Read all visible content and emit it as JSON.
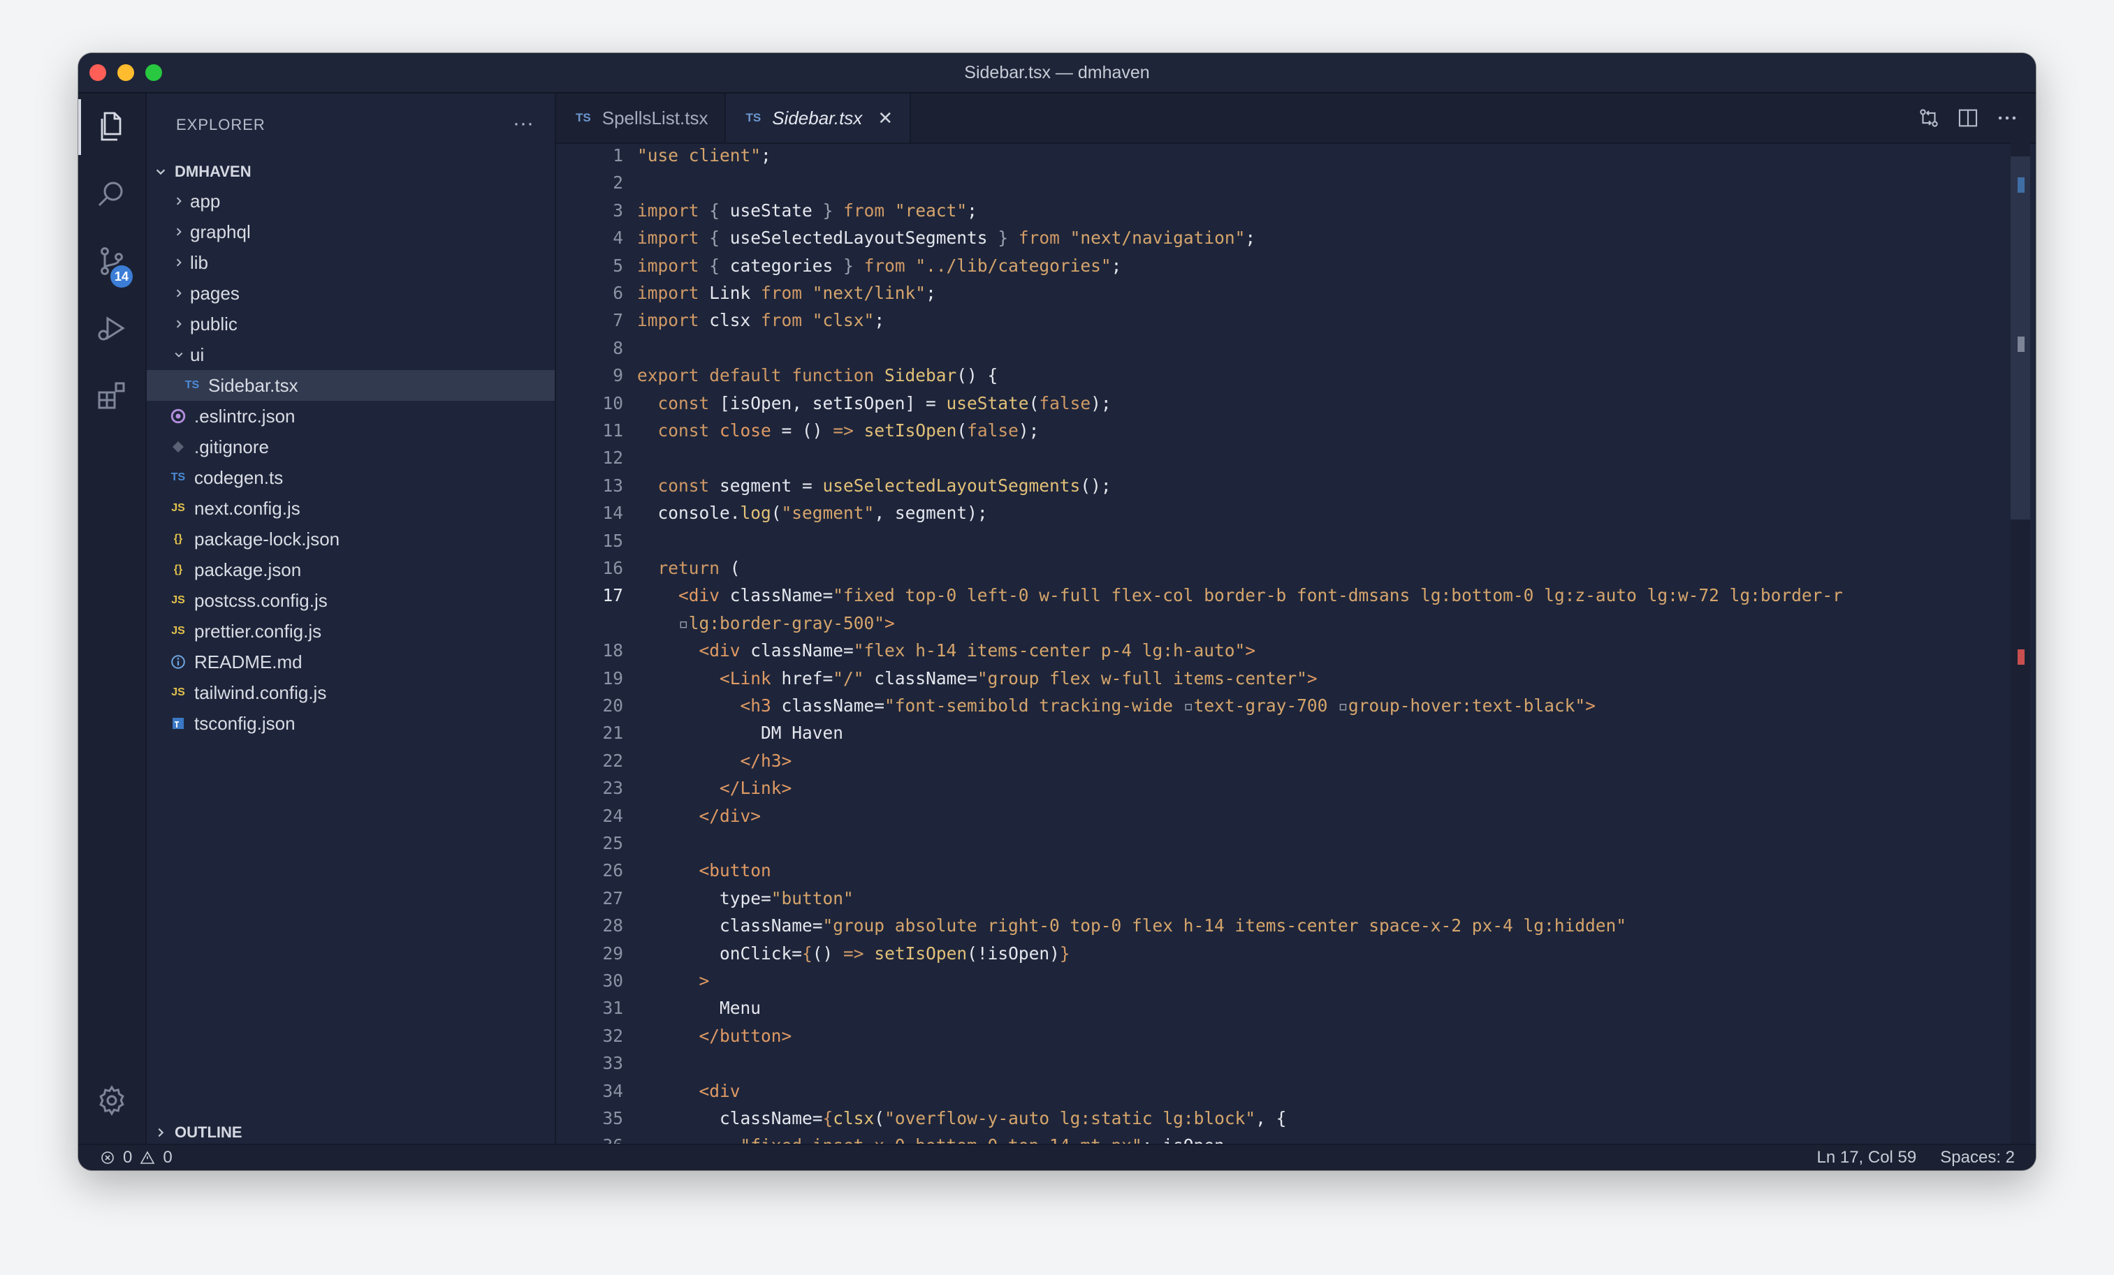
{
  "window": {
    "title": "Sidebar.tsx — dmhaven"
  },
  "activity_bar": {
    "items": [
      {
        "icon": "files-icon",
        "active": true
      },
      {
        "icon": "search-icon"
      },
      {
        "icon": "source-control-icon",
        "badge": "14"
      },
      {
        "icon": "run-debug-icon"
      },
      {
        "icon": "extensions-icon"
      }
    ],
    "settings_icon": "gear-icon"
  },
  "explorer": {
    "title": "EXPLORER",
    "more": "···",
    "root": "DMHAVEN",
    "outline": "OUTLINE",
    "tree": [
      {
        "label": "app",
        "type": "folder",
        "depth": 0,
        "expanded": false
      },
      {
        "label": "graphql",
        "type": "folder",
        "depth": 0,
        "expanded": false
      },
      {
        "label": "lib",
        "type": "folder",
        "depth": 0,
        "expanded": false
      },
      {
        "label": "pages",
        "type": "folder",
        "depth": 0,
        "expanded": false
      },
      {
        "label": "public",
        "type": "folder",
        "depth": 0,
        "expanded": false
      },
      {
        "label": "ui",
        "type": "folder",
        "depth": 0,
        "expanded": true
      },
      {
        "label": "Sidebar.tsx",
        "type": "file",
        "icon": "TS",
        "depth": 1,
        "selected": true
      },
      {
        "label": ".eslintrc.json",
        "type": "file",
        "icon": "eslint",
        "depth": 0
      },
      {
        "label": ".gitignore",
        "type": "file",
        "icon": "git",
        "depth": 0
      },
      {
        "label": "codegen.ts",
        "type": "file",
        "icon": "TS",
        "depth": 0
      },
      {
        "label": "next.config.js",
        "type": "file",
        "icon": "JS",
        "depth": 0
      },
      {
        "label": "package-lock.json",
        "type": "file",
        "icon": "{}",
        "depth": 0
      },
      {
        "label": "package.json",
        "type": "file",
        "icon": "{}",
        "depth": 0
      },
      {
        "label": "postcss.config.js",
        "type": "file",
        "icon": "JS",
        "depth": 0
      },
      {
        "label": "prettier.config.js",
        "type": "file",
        "icon": "JS",
        "depth": 0
      },
      {
        "label": "README.md",
        "type": "file",
        "icon": "info",
        "depth": 0
      },
      {
        "label": "tailwind.config.js",
        "type": "file",
        "icon": "JS",
        "depth": 0
      },
      {
        "label": "tsconfig.json",
        "type": "file",
        "icon": "tsconfig",
        "depth": 0
      }
    ]
  },
  "tabs": [
    {
      "prefix": "TS",
      "label": "SpellsList.tsx",
      "active": false
    },
    {
      "prefix": "TS",
      "label": "Sidebar.tsx",
      "active": true,
      "close": "✕"
    }
  ],
  "editor": {
    "current_line": "17",
    "lines": [
      {
        "n": "1",
        "t": [
          [
            "s",
            "\"use client\""
          ],
          [
            "pu",
            ";"
          ]
        ]
      },
      {
        "n": "2",
        "t": []
      },
      {
        "n": "3",
        "t": [
          [
            "k",
            "import"
          ],
          [
            "pu",
            " "
          ],
          [
            "dim",
            "{"
          ],
          [
            "pu",
            " useState "
          ],
          [
            "dim",
            "}"
          ],
          [
            "k",
            " from "
          ],
          [
            "s",
            "\"react\""
          ],
          [
            "pu",
            ";"
          ]
        ]
      },
      {
        "n": "4",
        "t": [
          [
            "k",
            "import"
          ],
          [
            "pu",
            " "
          ],
          [
            "dim",
            "{"
          ],
          [
            "pu",
            " useSelectedLayoutSegments "
          ],
          [
            "dim",
            "}"
          ],
          [
            "k",
            " from "
          ],
          [
            "s",
            "\"next/navigation\""
          ],
          [
            "pu",
            ";"
          ]
        ]
      },
      {
        "n": "5",
        "t": [
          [
            "k",
            "import"
          ],
          [
            "pu",
            " "
          ],
          [
            "dim",
            "{"
          ],
          [
            "pu",
            " categories "
          ],
          [
            "dim",
            "}"
          ],
          [
            "k",
            " from "
          ],
          [
            "s",
            "\"../lib/categories\""
          ],
          [
            "pu",
            ";"
          ]
        ]
      },
      {
        "n": "6",
        "t": [
          [
            "k",
            "import"
          ],
          [
            "pu",
            " Link"
          ],
          [
            "k",
            " from "
          ],
          [
            "s",
            "\"next/link\""
          ],
          [
            "pu",
            ";"
          ]
        ]
      },
      {
        "n": "7",
        "t": [
          [
            "k",
            "import"
          ],
          [
            "pu",
            " clsx"
          ],
          [
            "k",
            " from "
          ],
          [
            "s",
            "\"clsx\""
          ],
          [
            "pu",
            ";"
          ]
        ]
      },
      {
        "n": "8",
        "t": []
      },
      {
        "n": "9",
        "t": [
          [
            "k",
            "export default function "
          ],
          [
            "fn",
            "Sidebar"
          ],
          [
            "pu",
            "() {"
          ]
        ]
      },
      {
        "n": "10",
        "t": [
          [
            "pu",
            "  "
          ],
          [
            "k",
            "const "
          ],
          [
            "pu",
            "[isOpen, setIsOpen] = "
          ],
          [
            "fn",
            "useState"
          ],
          [
            "pu",
            "("
          ],
          [
            "k",
            "false"
          ],
          [
            "pu",
            ");"
          ]
        ]
      },
      {
        "n": "11",
        "t": [
          [
            "pu",
            "  "
          ],
          [
            "k",
            "const "
          ],
          [
            "tag",
            "close"
          ],
          [
            "pu",
            " = () "
          ],
          [
            "k",
            "=>"
          ],
          [
            "pu",
            " "
          ],
          [
            "fn",
            "setIsOpen"
          ],
          [
            "pu",
            "("
          ],
          [
            "k",
            "false"
          ],
          [
            "pu",
            ");"
          ]
        ]
      },
      {
        "n": "12",
        "t": []
      },
      {
        "n": "13",
        "t": [
          [
            "pu",
            "  "
          ],
          [
            "k",
            "const "
          ],
          [
            "pu",
            "segment = "
          ],
          [
            "fn",
            "useSelectedLayoutSegments"
          ],
          [
            "pu",
            "();"
          ]
        ]
      },
      {
        "n": "14",
        "t": [
          [
            "pu",
            "  console."
          ],
          [
            "fn",
            "log"
          ],
          [
            "pu",
            "("
          ],
          [
            "s",
            "\"segment\""
          ],
          [
            "pu",
            ", segment);"
          ]
        ]
      },
      {
        "n": "15",
        "t": []
      },
      {
        "n": "16",
        "t": [
          [
            "pu",
            "  "
          ],
          [
            "k",
            "return"
          ],
          [
            "pu",
            " ("
          ]
        ]
      },
      {
        "n": "17",
        "t": [
          [
            "pu",
            "    "
          ],
          [
            "tag",
            "<div"
          ],
          [
            "pu",
            " className="
          ],
          [
            "s",
            "\"fixed top-0 left-0 w-full flex-col border-b font-dmsans lg:bottom-0 lg:z-auto lg:w-72 lg:border-r"
          ]
        ]
      },
      {
        "n": "",
        "t": [
          [
            "pu",
            "    "
          ],
          [
            "dim",
            "▫"
          ],
          [
            "s",
            "lg:border-gray-500\""
          ],
          [
            "tag",
            ">"
          ]
        ]
      },
      {
        "n": "18",
        "t": [
          [
            "pu",
            "      "
          ],
          [
            "tag",
            "<div"
          ],
          [
            "pu",
            " className="
          ],
          [
            "s",
            "\"flex h-14 items-center p-4 lg:h-auto\""
          ],
          [
            "tag",
            ">"
          ]
        ]
      },
      {
        "n": "19",
        "t": [
          [
            "pu",
            "        "
          ],
          [
            "tag",
            "<Link"
          ],
          [
            "pu",
            " href="
          ],
          [
            "s",
            "\"/\""
          ],
          [
            "pu",
            " className="
          ],
          [
            "s",
            "\"group flex w-full items-center\""
          ],
          [
            "tag",
            ">"
          ]
        ]
      },
      {
        "n": "20",
        "t": [
          [
            "pu",
            "          "
          ],
          [
            "tag",
            "<h3"
          ],
          [
            "pu",
            " className="
          ],
          [
            "s",
            "\"font-semibold tracking-wide "
          ],
          [
            "dim",
            "▫"
          ],
          [
            "s",
            "text-gray-700 "
          ],
          [
            "dim",
            "▫"
          ],
          [
            "s",
            "group-hover:text-black\""
          ],
          [
            "tag",
            ">"
          ]
        ]
      },
      {
        "n": "21",
        "t": [
          [
            "pu",
            "            DM Haven"
          ]
        ]
      },
      {
        "n": "22",
        "t": [
          [
            "pu",
            "          "
          ],
          [
            "tag",
            "</h3>"
          ]
        ]
      },
      {
        "n": "23",
        "t": [
          [
            "pu",
            "        "
          ],
          [
            "tag",
            "</Link>"
          ]
        ]
      },
      {
        "n": "24",
        "t": [
          [
            "pu",
            "      "
          ],
          [
            "tag",
            "</div>"
          ]
        ]
      },
      {
        "n": "25",
        "t": []
      },
      {
        "n": "26",
        "t": [
          [
            "pu",
            "      "
          ],
          [
            "tag",
            "<button"
          ]
        ]
      },
      {
        "n": "27",
        "t": [
          [
            "pu",
            "        type="
          ],
          [
            "s",
            "\"button\""
          ]
        ]
      },
      {
        "n": "28",
        "t": [
          [
            "pu",
            "        className="
          ],
          [
            "s",
            "\"group absolute right-0 top-0 flex h-14 items-center space-x-2 px-4 lg:hidden\""
          ]
        ]
      },
      {
        "n": "29",
        "t": [
          [
            "pu",
            "        onClick="
          ],
          [
            "k",
            "{"
          ],
          [
            "pu",
            "() "
          ],
          [
            "k",
            "=>"
          ],
          [
            "pu",
            " "
          ],
          [
            "fn",
            "setIsOpen"
          ],
          [
            "pu",
            "(!isOpen)"
          ],
          [
            "k",
            "}"
          ]
        ]
      },
      {
        "n": "30",
        "t": [
          [
            "pu",
            "      "
          ],
          [
            "tag",
            ">"
          ]
        ]
      },
      {
        "n": "31",
        "t": [
          [
            "pu",
            "        Menu"
          ]
        ]
      },
      {
        "n": "32",
        "t": [
          [
            "pu",
            "      "
          ],
          [
            "tag",
            "</button>"
          ]
        ]
      },
      {
        "n": "33",
        "t": []
      },
      {
        "n": "34",
        "t": [
          [
            "pu",
            "      "
          ],
          [
            "tag",
            "<div"
          ]
        ]
      },
      {
        "n": "35",
        "t": [
          [
            "pu",
            "        className="
          ],
          [
            "k",
            "{"
          ],
          [
            "fn",
            "clsx"
          ],
          [
            "pu",
            "("
          ],
          [
            "s",
            "\"overflow-y-auto lg:static lg:block\""
          ],
          [
            "pu",
            ", {"
          ]
        ]
      },
      {
        "n": "36",
        "t": [
          [
            "pu",
            "          "
          ],
          [
            "s",
            "\"fixed inset-x-0 bottom-0 top-14 mt-px\""
          ],
          [
            "pu",
            ": isOpen,"
          ]
        ]
      },
      {
        "n": "37",
        "t": [
          [
            "pu",
            "          "
          ],
          [
            "k",
            "hidden"
          ],
          [
            "pu",
            ": !isOpen,"
          ]
        ]
      }
    ]
  },
  "status": {
    "errors": "0",
    "warnings": "0",
    "position": "Ln 17, Col 59",
    "spaces": "Spaces: 2"
  }
}
